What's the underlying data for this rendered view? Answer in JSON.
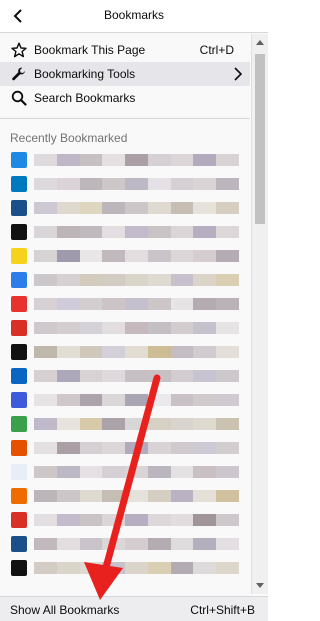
{
  "header": {
    "title": "Bookmarks",
    "back_icon": "back-arrow-icon"
  },
  "menu": [
    {
      "id": "bookmark-this-page",
      "icon": "star-icon",
      "label": "Bookmark This Page",
      "shortcut": "Ctrl+D"
    },
    {
      "id": "bookmarking-tools",
      "icon": "wrench-icon",
      "label": "Bookmarking Tools",
      "shortcut": "",
      "submenu": true
    },
    {
      "id": "search-bookmarks",
      "icon": "search-icon",
      "label": "Search Bookmarks",
      "shortcut": ""
    }
  ],
  "recent": {
    "label": "Recently Bookmarked",
    "items": [
      {
        "icon": "blue-logo-icon",
        "color": "#1e88e5"
      },
      {
        "icon": "trello-icon",
        "color": "#0079bf"
      },
      {
        "icon": "mail-envelope-icon",
        "color": "#1b4f8a"
      },
      {
        "icon": "m-letter-icon",
        "color": "#111111"
      },
      {
        "icon": "yellow-logo-icon",
        "color": "#f5d31a"
      },
      {
        "icon": "triangle-logo-icon",
        "color": "#2b7de9"
      },
      {
        "icon": "opera-icon",
        "color": "#e7322d"
      },
      {
        "icon": "gmail-icon",
        "color": "#d93025"
      },
      {
        "icon": "globe-icon",
        "color": "#111111"
      },
      {
        "icon": "linkedin-icon",
        "color": "#0a66c2"
      },
      {
        "icon": "c-circle-icon",
        "color": "#3b5bdb"
      },
      {
        "icon": "shield-lock-icon",
        "color": "#3aa14a"
      },
      {
        "icon": "orange-box-icon",
        "color": "#e65100"
      },
      {
        "icon": "news-logo-icon",
        "color": "#e8eef7"
      },
      {
        "icon": "orange-square-icon",
        "color": "#ef6c00"
      },
      {
        "icon": "gmail-icon-2",
        "color": "#d93025"
      },
      {
        "icon": "mail-envelope-icon-2",
        "color": "#1b4f8a"
      },
      {
        "icon": "wsj-icon",
        "color": "#111111"
      }
    ]
  },
  "footer": {
    "label": "Show All Bookmarks",
    "shortcut": "Ctrl+Shift+B"
  },
  "colors": {
    "annotation_arrow": "#e8201e",
    "selected_row": "#e6e6ea"
  }
}
